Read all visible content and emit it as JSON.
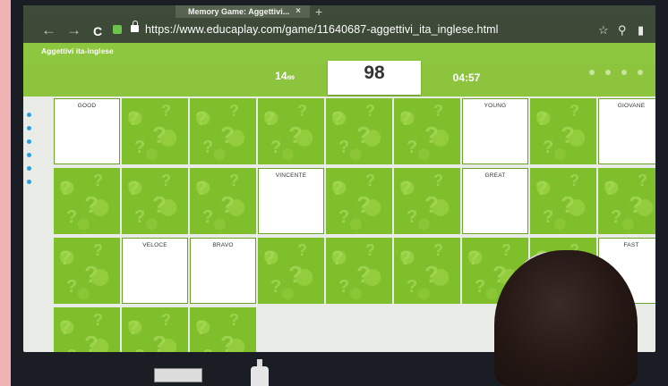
{
  "browser": {
    "tab_title": "Memory Game: Aggettivi...",
    "tab_close": "×",
    "new_tab": "+",
    "back": "←",
    "forward": "→",
    "reload": "C",
    "url": "https://www.educaplay.com/game/11640687-aggettivi_ita_inglese.html",
    "star_icon": "☆",
    "search_icon": "⚲",
    "bookmark_icon": "▮"
  },
  "app": {
    "title": "Aggettivi ita-inglese"
  },
  "stats": {
    "matches": "14",
    "matches_total": "/99",
    "matches_label": "",
    "score": "98",
    "score_label": "",
    "time": "04:57",
    "time_label": ""
  },
  "cards": [
    {
      "id": "c1",
      "face": "front",
      "word": "GOOD"
    },
    {
      "id": "c2",
      "face": "back"
    },
    {
      "id": "c3",
      "face": "back"
    },
    {
      "id": "c4",
      "face": "back"
    },
    {
      "id": "c5",
      "face": "back"
    },
    {
      "id": "c6",
      "face": "back"
    },
    {
      "id": "c7",
      "face": "front",
      "word": "YOUNG"
    },
    {
      "id": "c8",
      "face": "back"
    },
    {
      "id": "c9",
      "face": "front",
      "word": "GIOVANE"
    },
    {
      "id": "c10",
      "face": "back"
    },
    {
      "id": "c11",
      "face": "back"
    },
    {
      "id": "c12",
      "face": "back"
    },
    {
      "id": "c13",
      "face": "front",
      "word": "VINCENTE"
    },
    {
      "id": "c14",
      "face": "back"
    },
    {
      "id": "c15",
      "face": "back"
    },
    {
      "id": "c16",
      "face": "front",
      "word": "GREAT"
    },
    {
      "id": "c17",
      "face": "back"
    },
    {
      "id": "c18",
      "face": "back"
    },
    {
      "id": "c19",
      "face": "back"
    },
    {
      "id": "c20",
      "face": "front",
      "word": "VELOCE"
    },
    {
      "id": "c21",
      "face": "front",
      "word": "BRAVO"
    },
    {
      "id": "c22",
      "face": "back"
    },
    {
      "id": "c23",
      "face": "back"
    },
    {
      "id": "c24",
      "face": "back"
    },
    {
      "id": "c25",
      "face": "back"
    },
    {
      "id": "c26",
      "face": "back"
    },
    {
      "id": "c27",
      "face": "front",
      "word": "FAST"
    },
    {
      "id": "c28",
      "face": "back"
    },
    {
      "id": "c29",
      "face": "back"
    },
    {
      "id": "c30",
      "face": "back"
    }
  ]
}
